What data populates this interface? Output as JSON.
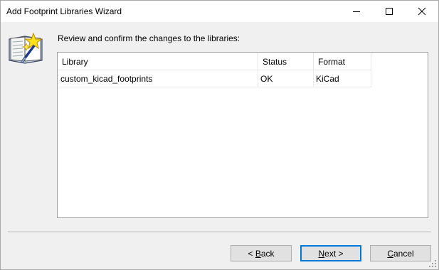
{
  "window": {
    "title": "Add Footprint Libraries Wizard"
  },
  "titlebar": {
    "minimize_icon": "minimize-icon",
    "maximize_icon": "maximize-icon",
    "close_icon": "close-icon"
  },
  "page": {
    "icon": "wizard-book-icon",
    "heading": "Review and confirm the changes to the libraries:"
  },
  "table": {
    "columns": [
      "Library",
      "Status",
      "Format"
    ],
    "rows": [
      {
        "library": "custom_kicad_footprints",
        "status": "OK",
        "format": "KiCad"
      }
    ]
  },
  "buttons": {
    "back": {
      "prefix": "< ",
      "mnemonic": "B",
      "rest": "ack"
    },
    "next": {
      "mnemonic": "N",
      "rest": "ext >"
    },
    "cancel": {
      "mnemonic": "C",
      "rest": "ancel"
    }
  },
  "colors": {
    "accent": "#0078d7",
    "background": "#f0f0f0"
  }
}
